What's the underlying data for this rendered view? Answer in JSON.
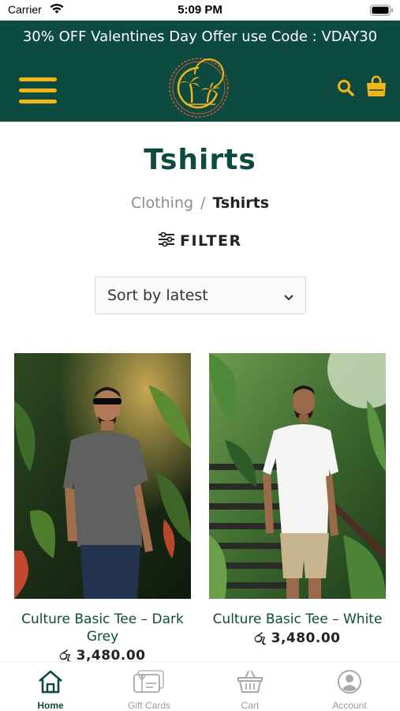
{
  "status_bar": {
    "carrier": "Carrier",
    "time": "5:09 PM"
  },
  "promo": {
    "text": "30% OFF Valentines Day Offer use Code : VDAY30"
  },
  "colors": {
    "brand": "#0d4a40",
    "accent": "#f1b51c",
    "logo_ring": "#c65a3a"
  },
  "header": {
    "menu_icon": "hamburger-icon",
    "logo_icon": "palm-tree-logo",
    "search_icon": "search-icon",
    "cart_icon": "shopping-bag-icon"
  },
  "page": {
    "title": "Tshirts"
  },
  "breadcrumb": {
    "parent": "Clothing",
    "separator": "/",
    "current": "Tshirts"
  },
  "filter": {
    "label": "FILTER"
  },
  "sort": {
    "selected": "Sort by latest"
  },
  "products": [
    {
      "name": "Culture Basic Tee – Dark Grey",
      "price": "රු 3,480.00",
      "shirt_color": "#5e615e"
    },
    {
      "name": "Culture Basic Tee – White",
      "price": "රු 3,480.00",
      "shirt_color": "#f4f4f2"
    }
  ],
  "tabbar": {
    "items": [
      {
        "label": "Home",
        "icon": "home-icon",
        "active": true
      },
      {
        "label": "Gift Cards",
        "icon": "gift-card-icon",
        "active": false
      },
      {
        "label": "Cart",
        "icon": "basket-icon",
        "active": false
      },
      {
        "label": "Account",
        "icon": "account-icon",
        "active": false
      }
    ]
  }
}
